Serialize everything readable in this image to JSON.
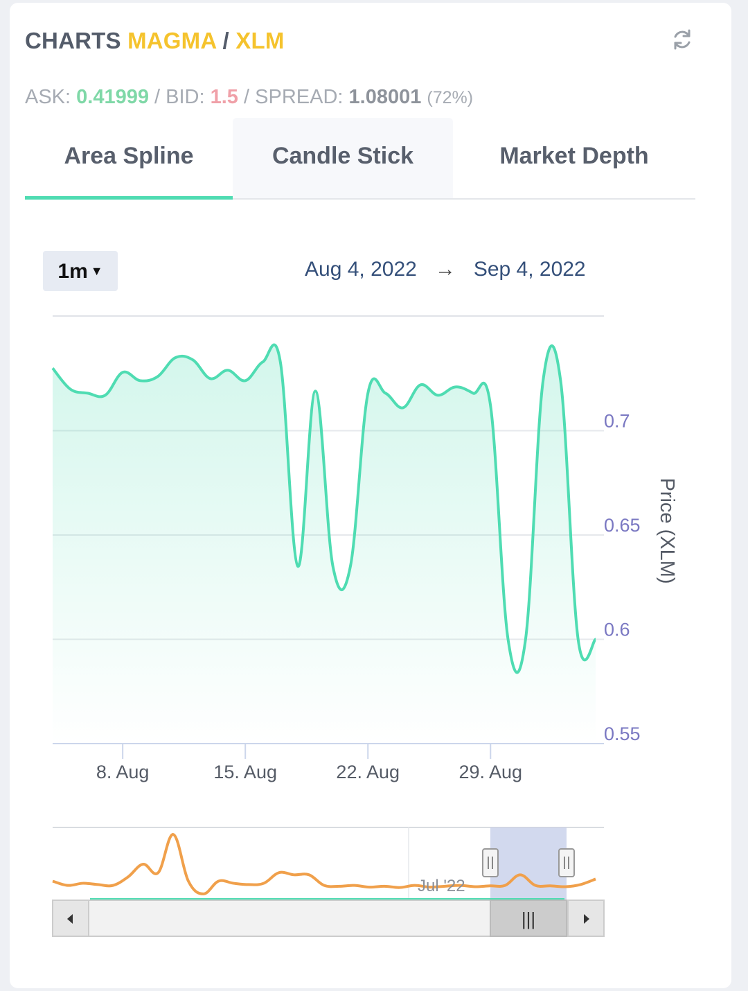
{
  "header": {
    "title_prefix": "CHARTS",
    "base": "MAGMA",
    "separator": "/",
    "quote": "XLM",
    "refresh_icon": "refresh-icon"
  },
  "stats": {
    "ask_label": "ASK:",
    "ask_value": "0.41999",
    "bid_label": "/ BID:",
    "bid_value": "1.5",
    "spread_label": "/ SPREAD:",
    "spread_value": "1.08001",
    "spread_pct": "(72%)"
  },
  "tabs": [
    {
      "label": "Area Spline",
      "active": true
    },
    {
      "label": "Candle Stick",
      "active": false
    },
    {
      "label": "Market Depth",
      "active": false
    }
  ],
  "controls": {
    "range": "1m",
    "date_from": "Aug 4, 2022",
    "arrow": "→",
    "date_to": "Sep 4, 2022"
  },
  "colors": {
    "line": "#4fdcb2",
    "navigator_line": "#f0a04b",
    "accent": "#4fdcb2"
  },
  "chart_data": {
    "type": "area",
    "ylabel": "Price (XLM)",
    "ylim": [
      0.55,
      0.755
    ],
    "xlim": [
      "2022-08-04",
      "2022-09-04"
    ],
    "y_ticks": [
      "0.7",
      "0.65",
      "0.6",
      "0.55"
    ],
    "y_tick_values": [
      0.7,
      0.65,
      0.6,
      0.55
    ],
    "x_ticks": [
      "8. Aug",
      "15. Aug",
      "22. Aug",
      "29. Aug"
    ],
    "x_tick_values": [
      "2022-08-08",
      "2022-08-15",
      "2022-08-22",
      "2022-08-29"
    ],
    "grid": true,
    "series": [
      {
        "x": [
          "2022-08-04",
          "2022-08-05",
          "2022-08-06",
          "2022-08-07",
          "2022-08-08",
          "2022-08-09",
          "2022-08-10",
          "2022-08-11",
          "2022-08-12",
          "2022-08-13",
          "2022-08-14",
          "2022-08-15",
          "2022-08-16",
          "2022-08-17",
          "2022-08-18",
          "2022-08-19",
          "2022-08-20",
          "2022-08-21",
          "2022-08-22",
          "2022-08-23",
          "2022-08-24",
          "2022-08-25",
          "2022-08-26",
          "2022-08-27",
          "2022-08-28",
          "2022-08-29",
          "2022-08-30",
          "2022-08-31",
          "2022-09-01",
          "2022-09-02",
          "2022-09-03",
          "2022-09-04"
        ],
        "values": [
          0.73,
          0.72,
          0.718,
          0.717,
          0.728,
          0.724,
          0.726,
          0.735,
          0.734,
          0.725,
          0.729,
          0.724,
          0.733,
          0.733,
          0.635,
          0.719,
          0.635,
          0.635,
          0.718,
          0.718,
          0.711,
          0.722,
          0.717,
          0.721,
          0.718,
          0.712,
          0.6,
          0.6,
          0.724,
          0.724,
          0.6,
          0.6
        ]
      }
    ]
  },
  "navigator": {
    "label": "Jul '22",
    "values": [
      0.62,
      0.61,
      0.615,
      0.612,
      0.61,
      0.63,
      0.66,
      0.64,
      0.73,
      0.62,
      0.59,
      0.62,
      0.615,
      0.612,
      0.615,
      0.64,
      0.635,
      0.635,
      0.61,
      0.608,
      0.61,
      0.606,
      0.608,
      0.605,
      0.61,
      0.606,
      0.608,
      0.61,
      0.607,
      0.609,
      0.61,
      0.635,
      0.61,
      0.609,
      0.607,
      0.612,
      0.625
    ],
    "scrollbar_grip": "|||",
    "left_arrow_icon": "arrow-left-icon",
    "right_arrow_icon": "arrow-right-icon"
  }
}
